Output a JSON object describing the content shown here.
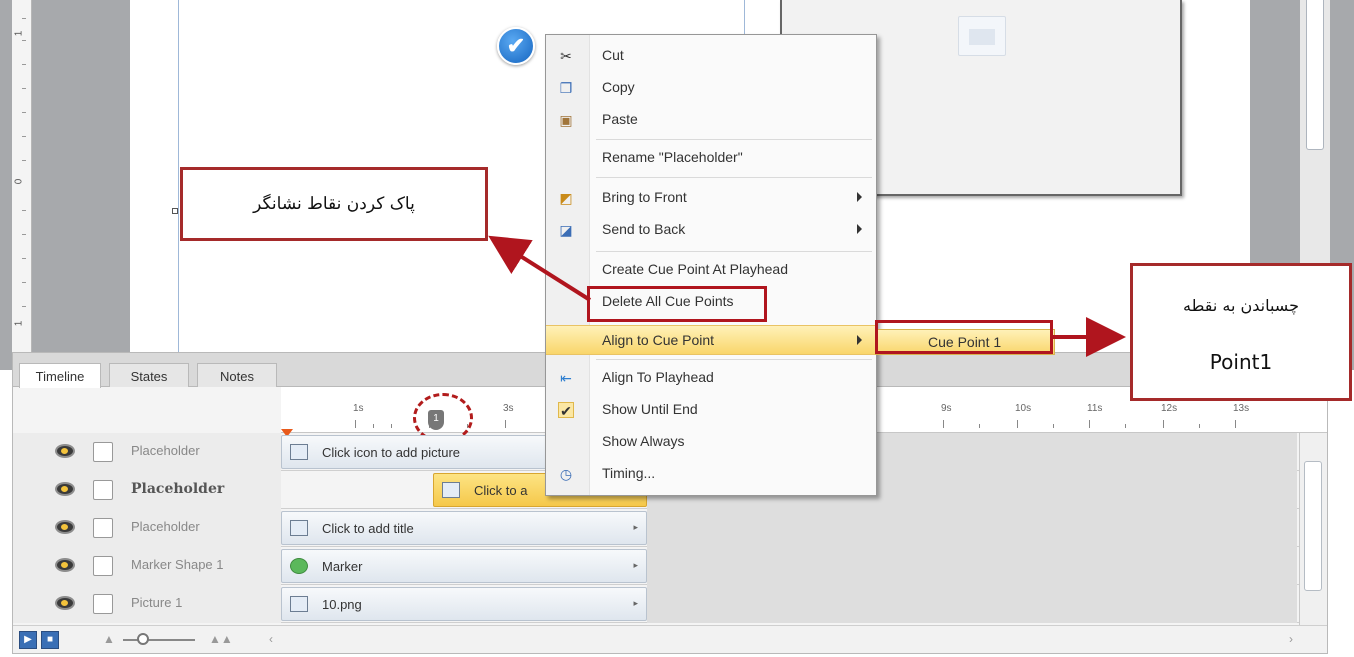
{
  "ruler": {
    "v_marks": [
      "1",
      "0",
      "1"
    ]
  },
  "timeline": {
    "tabs": [
      "Timeline",
      "States",
      "Notes"
    ],
    "time_labels": [
      "1s",
      "3s",
      "9s",
      "10s",
      "11s",
      "12s",
      "13s"
    ],
    "cue_marker": "1",
    "rows": [
      {
        "name": "Placeholder",
        "bar_text": "Click icon to add picture",
        "bold": false
      },
      {
        "name": "Placeholder",
        "bar_text": "Click to a",
        "bold": true
      },
      {
        "name": "Placeholder",
        "bar_text": "Click to add title",
        "bold": false
      },
      {
        "name": "Marker Shape 1",
        "bar_text": "Marker",
        "bold": false
      },
      {
        "name": "Picture 1",
        "bar_text": "10.png",
        "bold": false
      }
    ]
  },
  "context_menu": {
    "items": [
      {
        "label": "Cut",
        "icon": "scissors-icon"
      },
      {
        "label": "Copy",
        "icon": "copy-icon"
      },
      {
        "label": "Paste",
        "icon": "paste-icon"
      },
      {
        "label": "Rename \"Placeholder\""
      },
      {
        "label": "Bring to Front",
        "icon": "bring-front-icon"
      },
      {
        "label": "Send to Back",
        "icon": "send-back-icon"
      },
      {
        "label": "Create Cue Point At Playhead"
      },
      {
        "label": "Delete All Cue Points"
      },
      {
        "label": "Align to Cue Point"
      },
      {
        "label": "Align To Playhead",
        "icon": "align-playhead-icon"
      },
      {
        "label": "Show Until End",
        "icon": "check-icon"
      },
      {
        "label": "Show Always"
      },
      {
        "label": "Timing...",
        "icon": "clock-icon"
      }
    ],
    "submenu_item": "Cue Point 1"
  },
  "annotations": {
    "left_note": "پاک کردن نقاط نشانگر",
    "right_note_line1": "چسباندن به نقطه",
    "right_note_line2": "Point1"
  },
  "colors": {
    "annotation_red": "#b0151e",
    "highlight_yellow": "#f9d66b",
    "playhead_orange": "#e85a1b"
  }
}
